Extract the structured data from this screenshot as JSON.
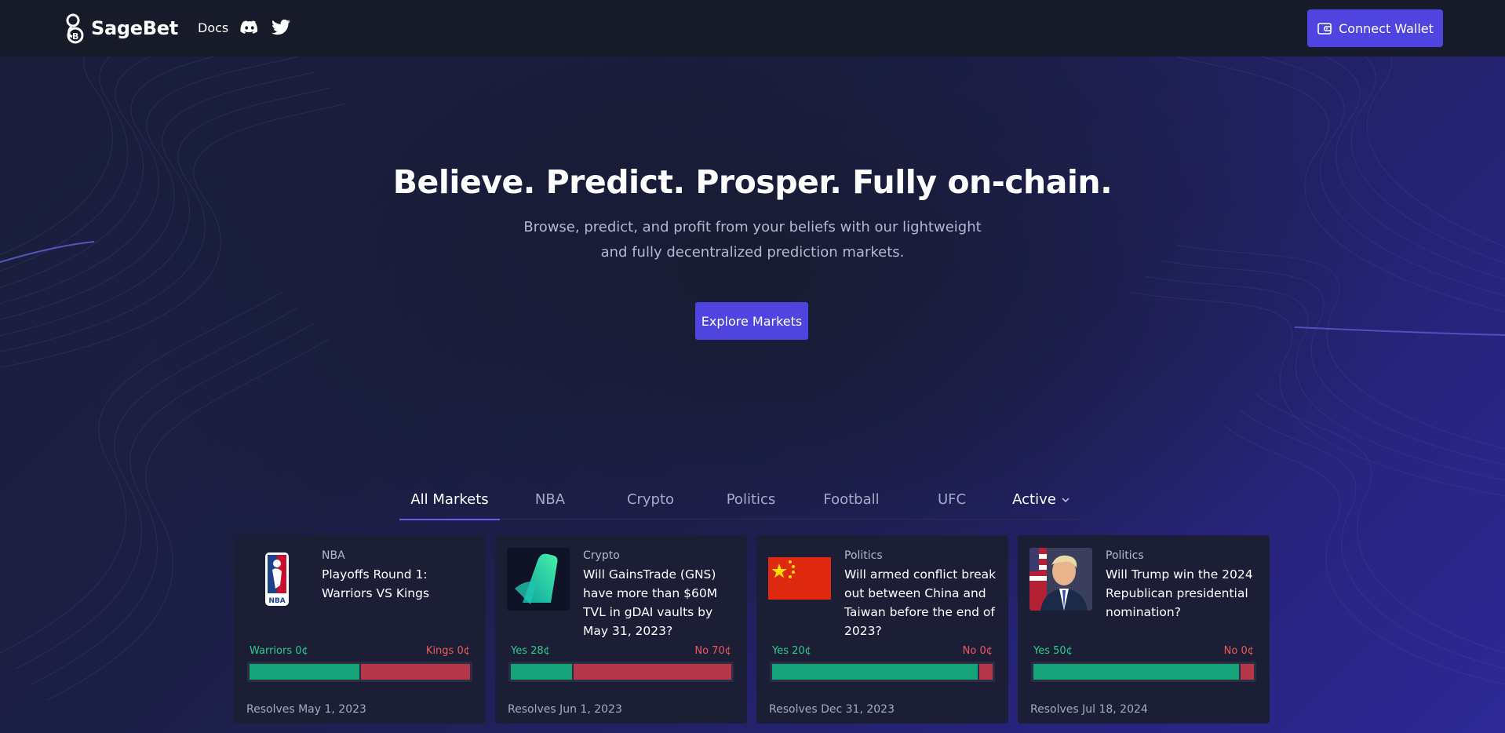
{
  "brand": {
    "name": "SageBet"
  },
  "nav": {
    "docs_label": "Docs",
    "discord_icon": "discord-icon",
    "twitter_icon": "twitter-icon"
  },
  "wallet": {
    "label": "Connect Wallet",
    "icon": "wallet-icon"
  },
  "hero": {
    "title": "Believe. Predict. Prosper. Fully on-chain.",
    "subtitle": "Browse, predict, and profit from your beliefs with our lightweight and fully decentralized prediction markets.",
    "cta_label": "Explore Markets"
  },
  "tabs": [
    {
      "label": "All Markets",
      "active": true
    },
    {
      "label": "NBA",
      "active": false
    },
    {
      "label": "Crypto",
      "active": false
    },
    {
      "label": "Politics",
      "active": false
    },
    {
      "label": "Football",
      "active": false
    },
    {
      "label": "UFC",
      "active": false
    }
  ],
  "filter": {
    "selected": "Active"
  },
  "colors": {
    "accent": "#4f44e0",
    "yes": "#16a37a",
    "no": "#b5384a",
    "yes_text": "#2ecc8f",
    "no_text": "#ef5a5a"
  },
  "markets": [
    {
      "category": "NBA",
      "title": "Playoffs Round 1: Warriors VS Kings",
      "yes_label": "Warriors 0¢",
      "no_label": "Kings 0¢",
      "yes_share": 0.5,
      "resolves": "Resolves May 1, 2023",
      "image": "nba-logo"
    },
    {
      "category": "Crypto",
      "title": "Will GainsTrade (GNS) have more than $60M TVL in gDAI vaults by May 31, 2023?",
      "yes_label": "Yes 28¢",
      "no_label": "No 70¢",
      "yes_share": 0.28,
      "resolves": "Resolves Jun 1, 2023",
      "image": "gains-logo"
    },
    {
      "category": "Politics",
      "title": "Will armed conflict break out between China and Taiwan before the end of 2023?",
      "yes_label": "Yes 20¢",
      "no_label": "No 0¢",
      "yes_share": 0.94,
      "resolves": "Resolves Dec 31, 2023",
      "image": "china-flag"
    },
    {
      "category": "Politics",
      "title": "Will Trump win the 2024 Republican presidential nomination?",
      "yes_label": "Yes 50¢",
      "no_label": "No 0¢",
      "yes_share": 0.94,
      "resolves": "Resolves Jul 18, 2024",
      "image": "trump-portrait"
    }
  ]
}
